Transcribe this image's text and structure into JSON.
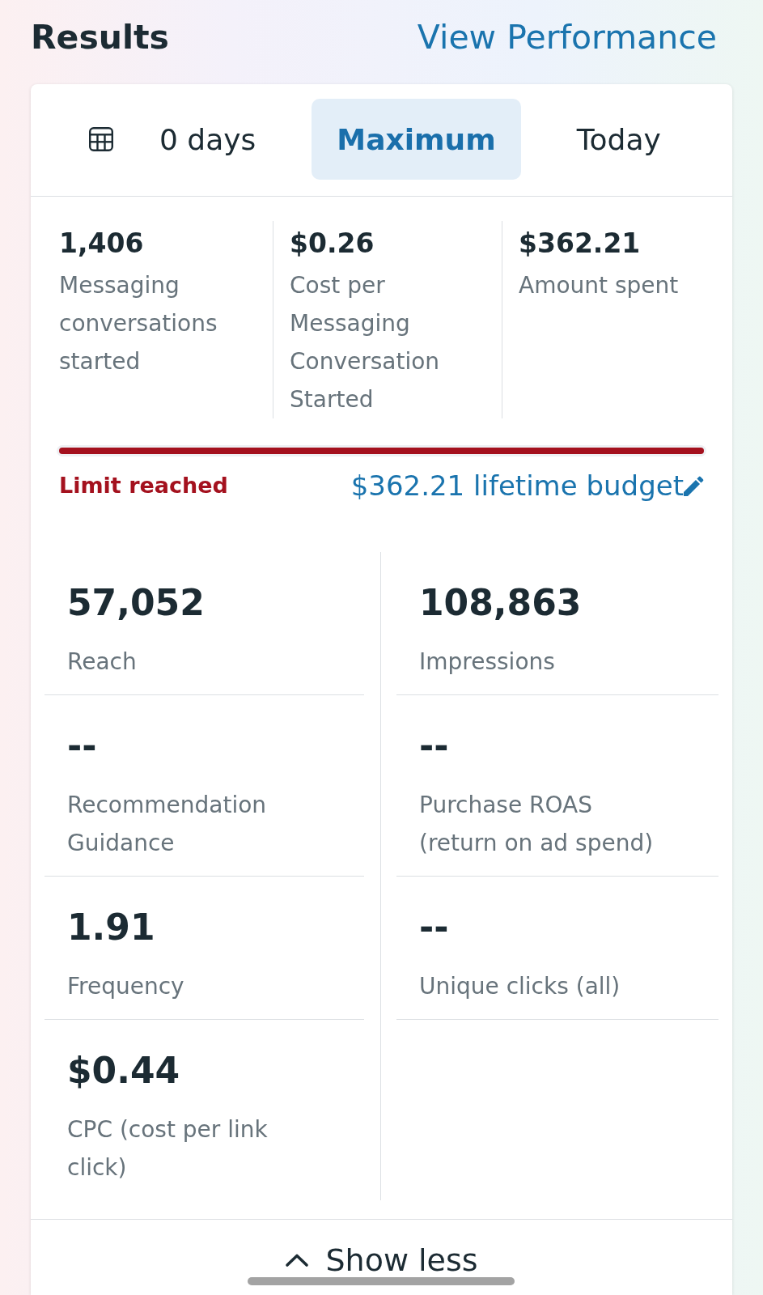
{
  "header": {
    "title": "Results",
    "link": "View Performance"
  },
  "date_tabs": [
    {
      "kind": "date_range",
      "label": "0 days",
      "selected": false
    },
    {
      "kind": "preset",
      "label": "Maximum",
      "selected": true
    },
    {
      "kind": "preset",
      "label": "Today",
      "selected": false
    }
  ],
  "summary": [
    {
      "value": "1,406",
      "label": "Messaging conversations started"
    },
    {
      "value": "$0.26",
      "label": "Cost per Messaging Conversation Started"
    },
    {
      "value": "$362.21",
      "label": "Amount spent"
    }
  ],
  "budget": {
    "level": 1,
    "status": "Limit reached",
    "amount": "$362.21 lifetime budget"
  },
  "metrics": [
    {
      "value": "57,052",
      "label": "Reach"
    },
    {
      "value": "108,863",
      "label": "Impressions"
    },
    {
      "value": "--",
      "label": "Recommendation Guidance"
    },
    {
      "value": "--",
      "label": "Purchase ROAS (return on ad spend)"
    },
    {
      "value": "1.91",
      "label": "Frequency"
    },
    {
      "value": "--",
      "label": "Unique clicks (all)"
    },
    {
      "value": "$0.44",
      "label": "CPC (cost per link click)"
    }
  ],
  "show_less": "Show less"
}
